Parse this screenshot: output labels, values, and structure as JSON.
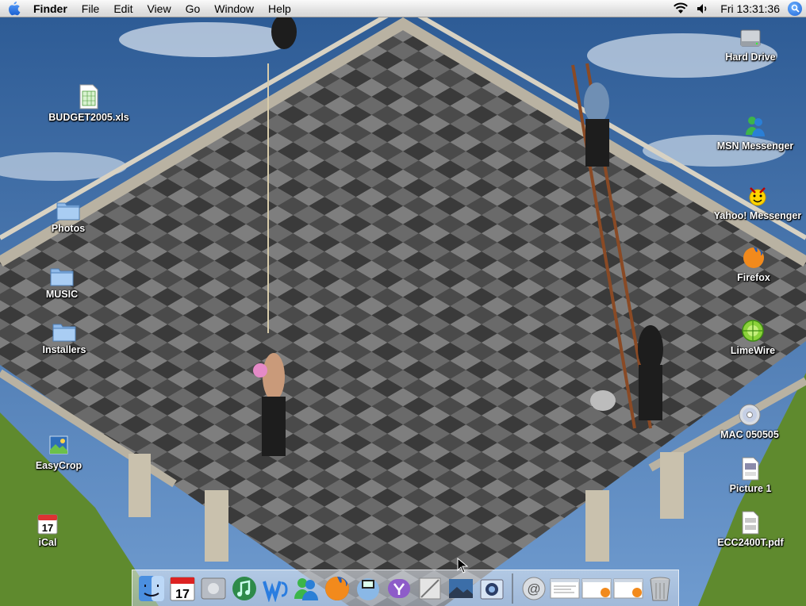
{
  "menubar": {
    "app_name": "Finder",
    "menus": [
      "File",
      "Edit",
      "View",
      "Go",
      "Window",
      "Help"
    ],
    "clock": "Fri 13:31:36",
    "status_icons": [
      "wifi-icon",
      "volume-icon",
      "spotlight-icon"
    ]
  },
  "desktop": {
    "left_icons": [
      {
        "label": "BUDGET2005.xls",
        "icon": "spreadsheet-file-icon"
      },
      {
        "label": "Photos",
        "icon": "folder-icon"
      },
      {
        "label": "MUSIC",
        "icon": "folder-icon"
      },
      {
        "label": "Installers",
        "icon": "folder-icon"
      },
      {
        "label": "EasyCrop",
        "icon": "easycrop-app-icon"
      },
      {
        "label": "iCal",
        "icon": "ical-icon"
      }
    ],
    "right_icons": [
      {
        "label": "Hard Drive",
        "icon": "hard-drive-icon"
      },
      {
        "label": "MSN Messenger",
        "icon": "msn-messenger-icon"
      },
      {
        "label": "Yahoo! Messenger",
        "icon": "yahoo-messenger-icon"
      },
      {
        "label": "Firefox",
        "icon": "firefox-icon"
      },
      {
        "label": "LimeWire",
        "icon": "limewire-icon"
      },
      {
        "label": "MAC 050505",
        "icon": "cd-disc-icon"
      },
      {
        "label": "Picture 1",
        "icon": "png-file-icon"
      },
      {
        "label": "ECC2400T.pdf",
        "icon": "pdf-file-icon"
      }
    ],
    "ical_date": "17"
  },
  "dock": {
    "apps": [
      "finder-icon",
      "ical-icon",
      "system-prefs-icon",
      "itunes-icon",
      "word-icon",
      "msn-messenger-icon",
      "firefox-icon",
      "network-icon",
      "yahoo-icon",
      "preview-icon",
      "photo-icon",
      "iphoto-icon"
    ],
    "docs": [
      "mail-icon",
      "minimized-window-icon",
      "minimized-window-icon",
      "minimized-window-icon",
      "trash-icon"
    ],
    "ical_date": "17"
  },
  "colors": {
    "sky": "#3f6fa8",
    "floor_dark": "#3c3c3c",
    "floor_light": "#9a9a9a",
    "menubar_bg": "#e8e8e8",
    "spotlight": "#1d63d6"
  }
}
